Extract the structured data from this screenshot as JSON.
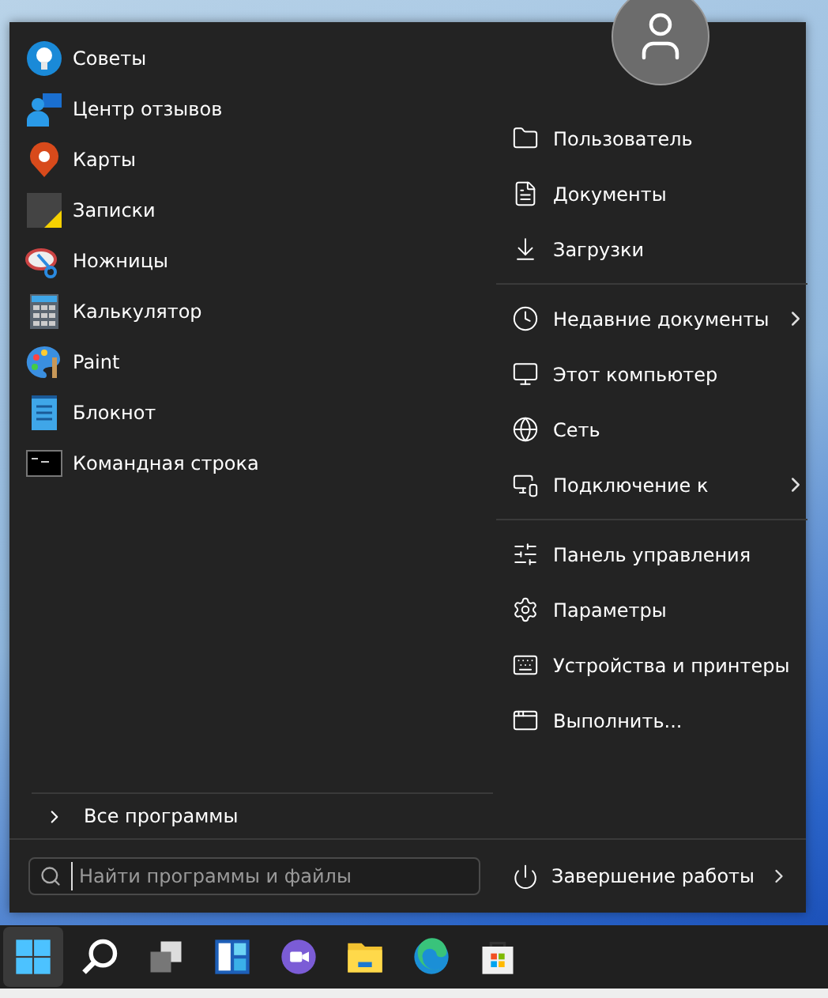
{
  "apps": [
    {
      "label": "Советы",
      "kind": "tips"
    },
    {
      "label": "Центр отзывов",
      "kind": "feedback"
    },
    {
      "label": "Карты",
      "kind": "maps"
    },
    {
      "label": "Записки",
      "kind": "notes"
    },
    {
      "label": "Ножницы",
      "kind": "snip"
    },
    {
      "label": "Калькулятор",
      "kind": "calc"
    },
    {
      "label": "Paint",
      "kind": "paint"
    },
    {
      "label": "Блокнот",
      "kind": "notepad"
    },
    {
      "label": "Командная строка",
      "kind": "cmd"
    }
  ],
  "all_programs": {
    "label": "Все программы"
  },
  "search": {
    "placeholder": "Найти программы и файлы"
  },
  "places": [
    [
      {
        "label": "Пользователь",
        "kind": "user",
        "submenu": false
      },
      {
        "label": "Документы",
        "kind": "docs",
        "submenu": false
      },
      {
        "label": "Загрузки",
        "kind": "downloads",
        "submenu": false
      }
    ],
    [
      {
        "label": "Недавние документы",
        "kind": "recent",
        "submenu": true
      },
      {
        "label": "Этот компьютер",
        "kind": "pc",
        "submenu": false
      },
      {
        "label": "Сеть",
        "kind": "network",
        "submenu": false
      },
      {
        "label": "Подключение к",
        "kind": "connect",
        "submenu": true
      }
    ],
    [
      {
        "label": "Панель управления",
        "kind": "control",
        "submenu": false
      },
      {
        "label": "Параметры",
        "kind": "settings",
        "submenu": false
      },
      {
        "label": "Устройства и принтеры",
        "kind": "devices",
        "submenu": false
      },
      {
        "label": "Выполнить...",
        "kind": "run",
        "submenu": false
      }
    ]
  ],
  "shutdown": {
    "label": "Завершение работы",
    "submenu": true
  },
  "taskbar": [
    {
      "kind": "start",
      "selected": true
    },
    {
      "kind": "search",
      "selected": false
    },
    {
      "kind": "taskview",
      "selected": false
    },
    {
      "kind": "widgets",
      "selected": false
    },
    {
      "kind": "chat",
      "selected": false
    },
    {
      "kind": "explorer",
      "selected": false
    },
    {
      "kind": "edge",
      "selected": false
    },
    {
      "kind": "store",
      "selected": false
    }
  ]
}
